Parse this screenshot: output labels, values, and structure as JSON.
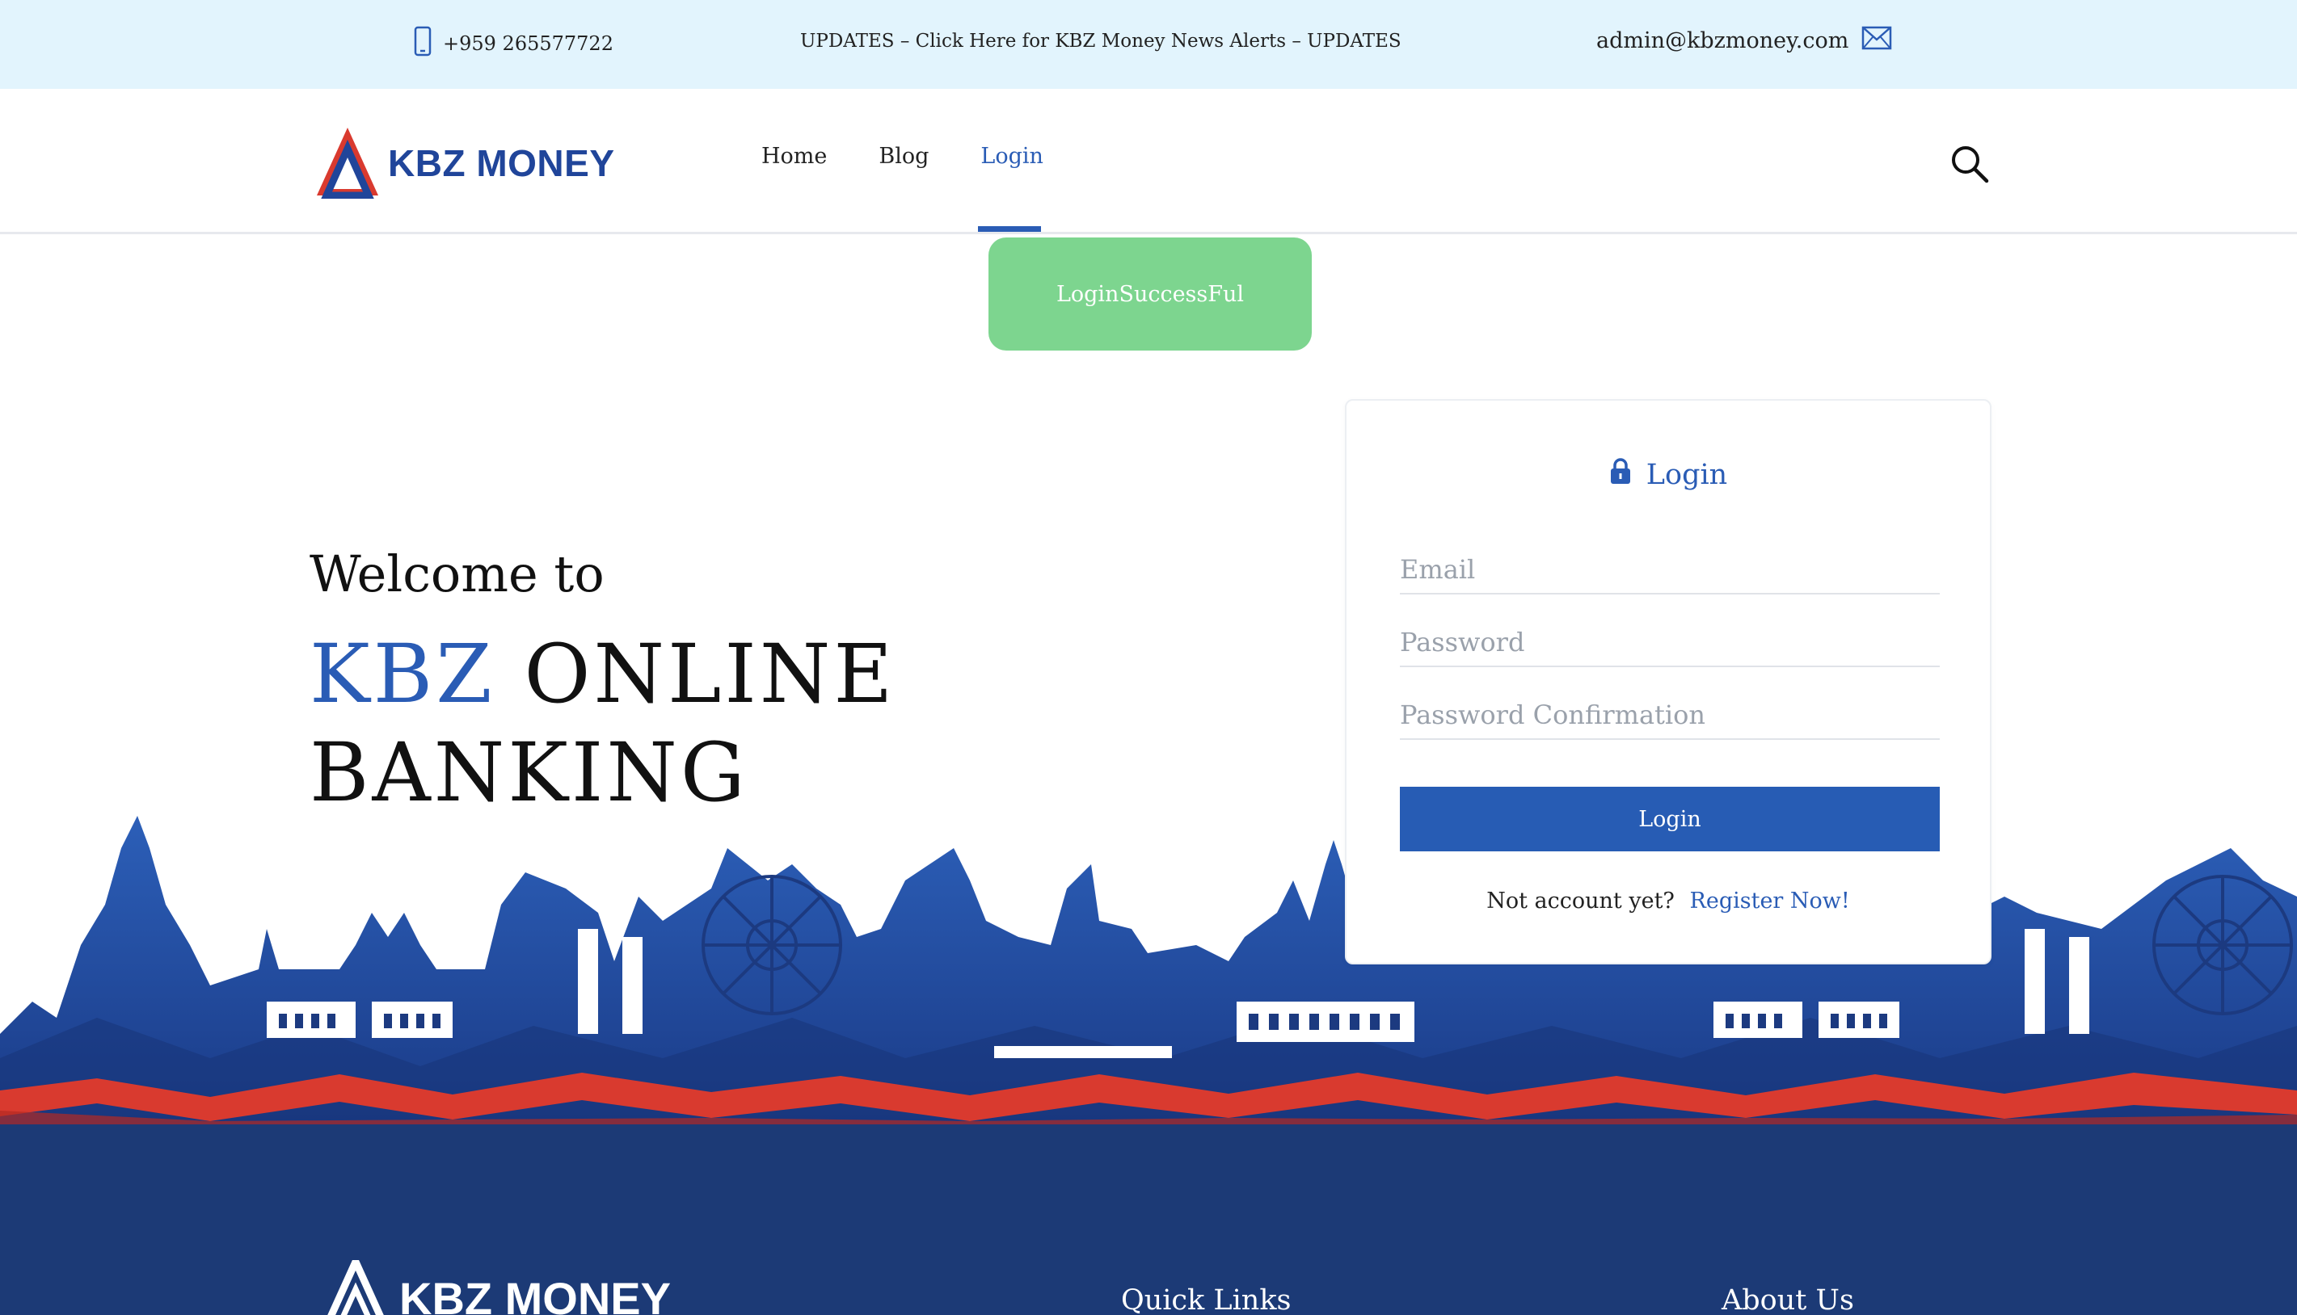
{
  "topbar": {
    "phone": "+959 265577722",
    "updates": "UPDATES – Click Here for KBZ Money News Alerts – UPDATES",
    "email": "admin@kbzmoney.com"
  },
  "brand": {
    "name": "KBZ MONEY"
  },
  "nav": {
    "items": [
      {
        "label": "Home"
      },
      {
        "label": "Blog"
      },
      {
        "label": "Login"
      }
    ],
    "active": "Login"
  },
  "toast": {
    "message": "LoginSuccessFul"
  },
  "hero": {
    "welcome": "Welcome to",
    "accent": "KBZ",
    "line1_rest": " ONLINE",
    "line2": "BANKING"
  },
  "login_form": {
    "title": "Login",
    "email_placeholder": "Email",
    "password_placeholder": "Password",
    "password_confirmation_placeholder": "Password Confirmation",
    "submit_label": "Login",
    "no_account_text": "Not account yet?",
    "register_link": "Register Now!"
  },
  "footer": {
    "brand": "KBZ MONEY",
    "quick_links_heading": "Quick Links",
    "about_heading": "About Us"
  },
  "colors": {
    "primary": "#2a5cb5",
    "topbar_bg": "#e2f4fd",
    "toast_bg": "#7dd58f",
    "footer_bg": "#1c3a76",
    "skyline_red": "#d93a2f"
  }
}
